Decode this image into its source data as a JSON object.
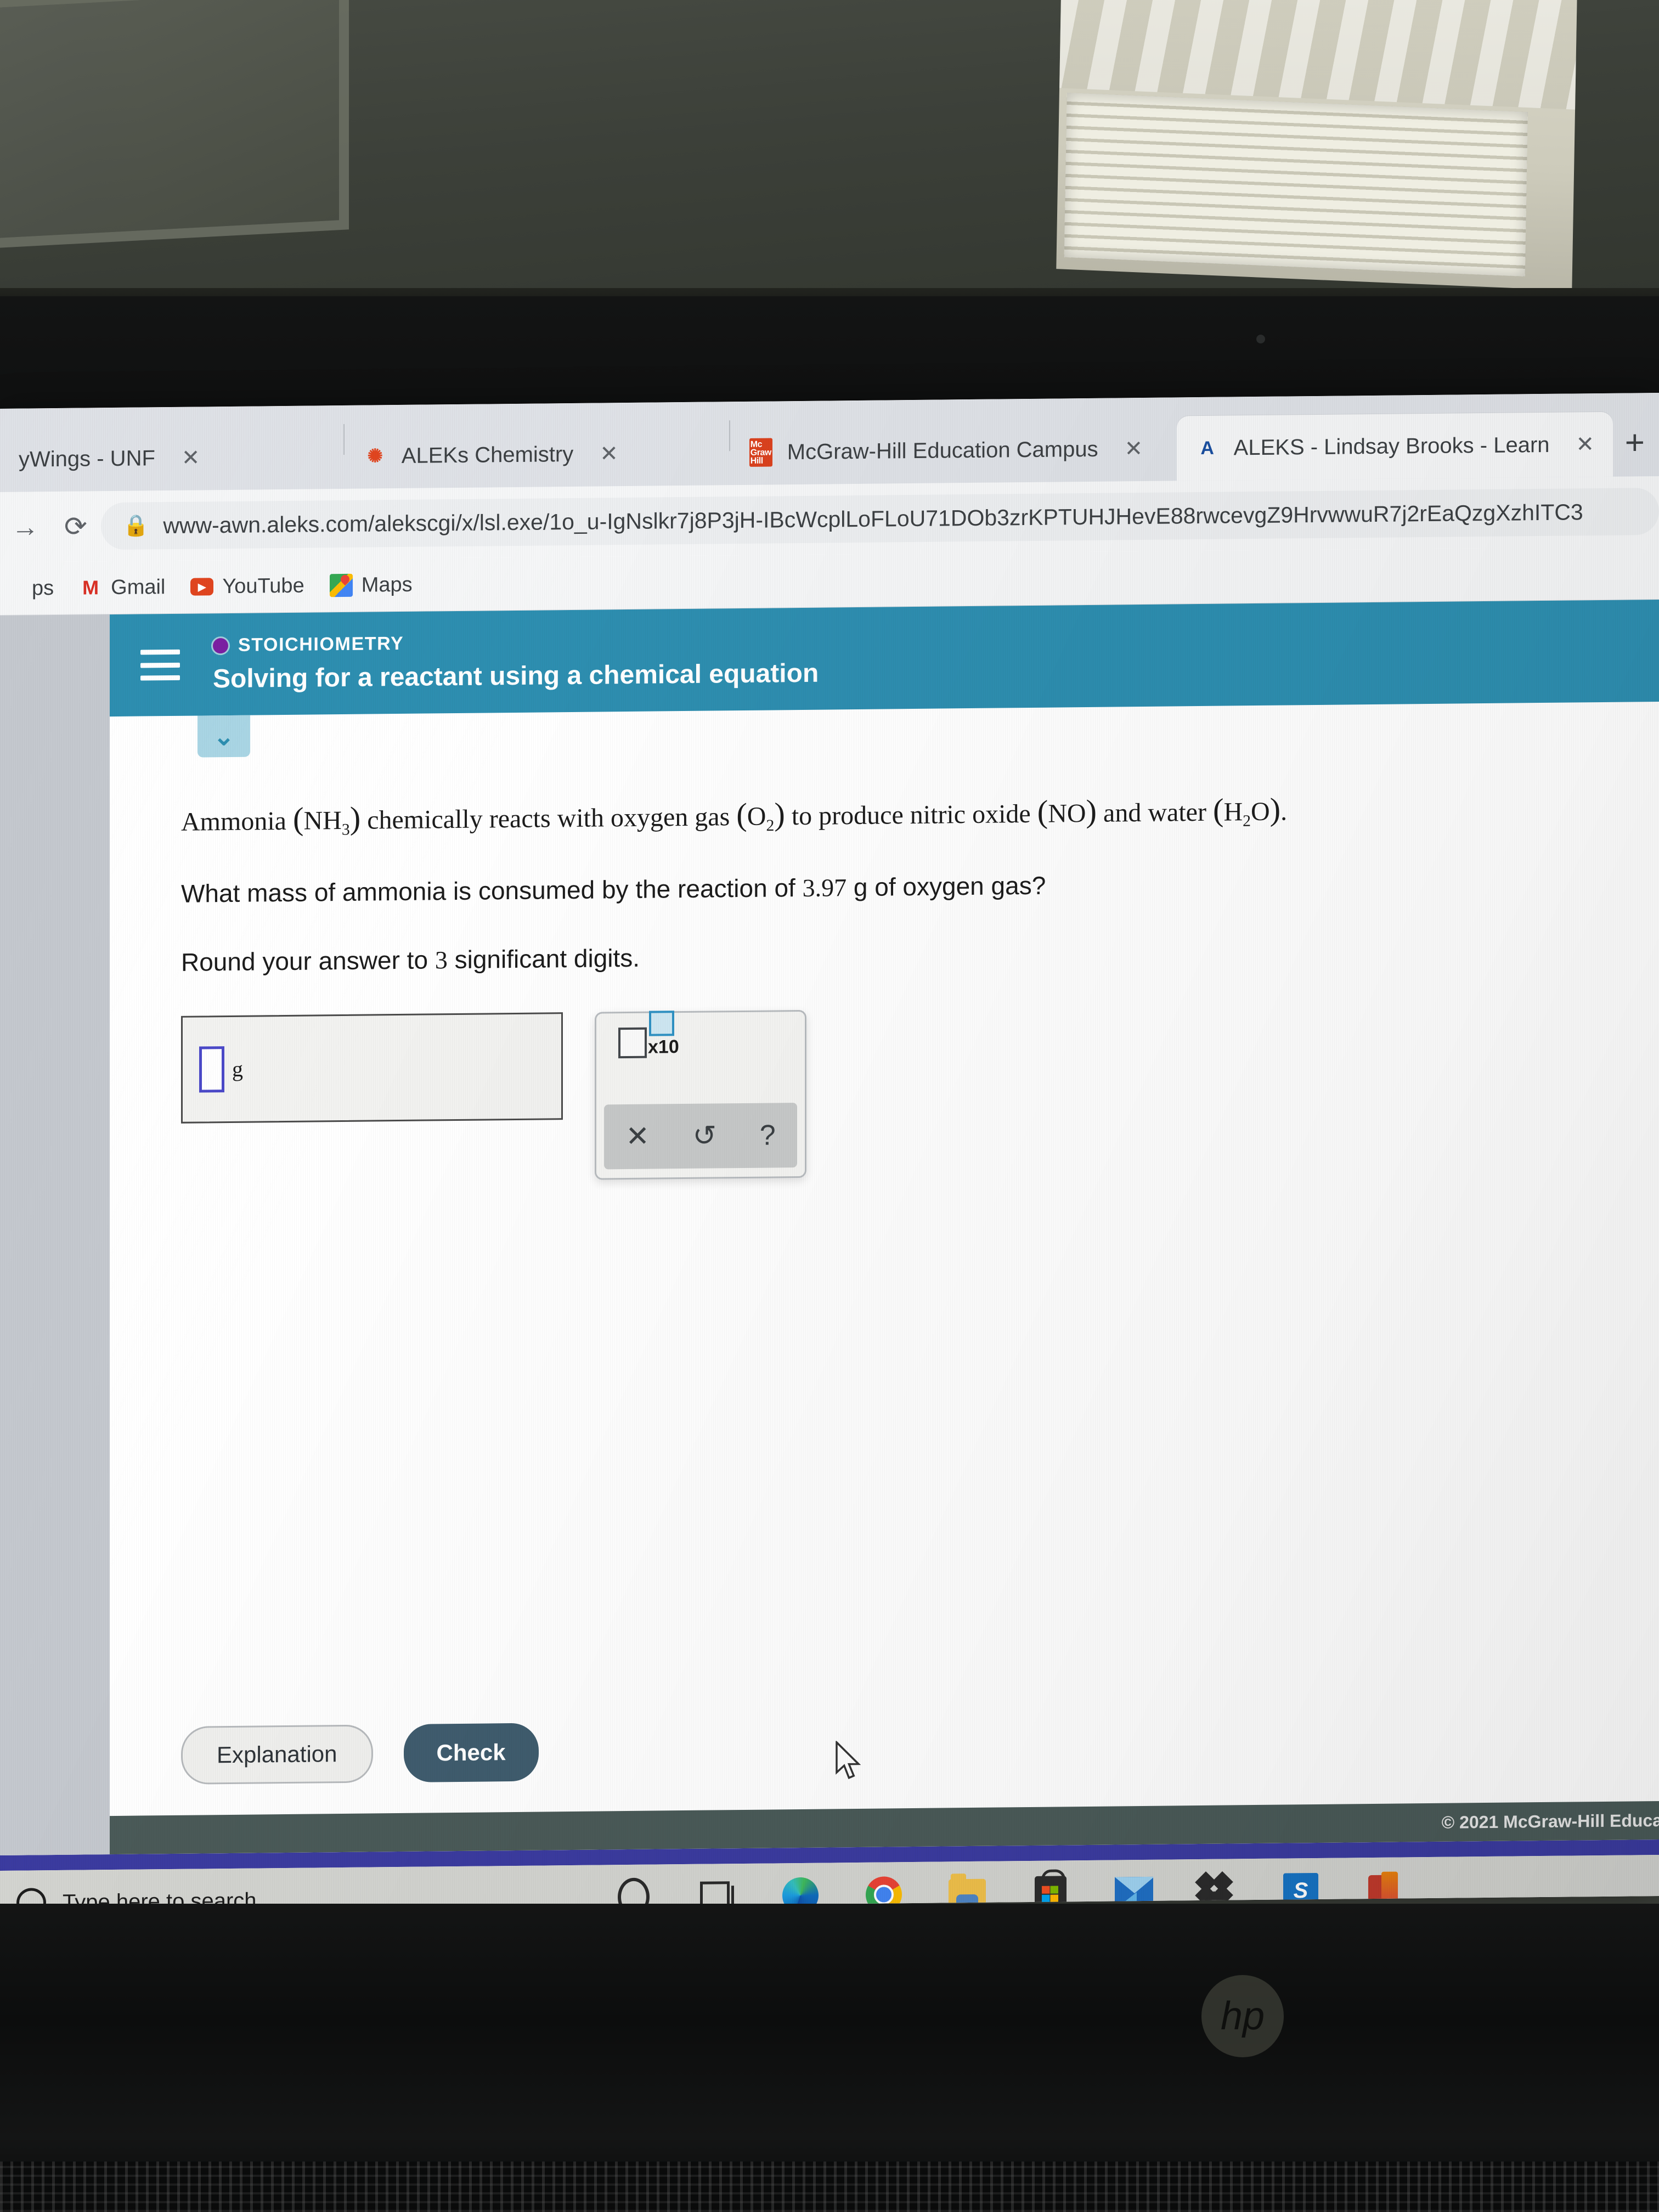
{
  "browser": {
    "tabs": [
      {
        "title": "yWings - UNF",
        "favicon": "none-icon",
        "active": false,
        "close_label": "✕"
      },
      {
        "title": "ALEKs Chemistry",
        "favicon": "aleks-chemistry-icon",
        "active": false,
        "close_label": "✕"
      },
      {
        "title": "McGraw-Hill Education Campus",
        "favicon": "mcgraw-hill-icon",
        "active": false,
        "close_label": "✕"
      },
      {
        "title": "ALEKS - Lindsay Brooks - Learn",
        "favicon": "aleks-icon",
        "active": true,
        "close_label": "✕"
      }
    ],
    "new_tab_label": "+",
    "reload_label": "⟳",
    "forward_label": "→",
    "lock_label": "🔒",
    "url": "www-awn.aleks.com/alekscgi/x/lsl.exe/1o_u-IgNslkr7j8P3jH-IBcWcplLoFLoU71DOb3zrKPTUHJHevE88rwcevgZ9HrvwwuR7j2rEaQzgXzhITC3",
    "bookmarks": [
      {
        "label": "ps",
        "icon": "apps-icon"
      },
      {
        "label": "Gmail",
        "icon": "gmail-icon"
      },
      {
        "label": "YouTube",
        "icon": "youtube-icon"
      },
      {
        "label": "Maps",
        "icon": "maps-icon"
      }
    ]
  },
  "aleks": {
    "menu_icon": "hamburger-menu-icon",
    "topic": "STOICHIOMETRY",
    "lesson_title": "Solving for a reactant using a chemical equation",
    "collapse_chevron": "⌄",
    "question": {
      "line1_prefix": "Ammonia",
      "line1_f1": "NH",
      "line1_f1_sub": "3",
      "line1_mid1": "chemically reacts with oxygen gas",
      "line1_f2": "O",
      "line1_f2_sub": "2",
      "line1_mid2": "to produce nitric oxide",
      "line1_f3": "NO",
      "line1_mid3": "and water",
      "line1_f4a": "H",
      "line1_f4_sub": "2",
      "line1_f4b": "O",
      "line1_end": ".",
      "line2_prefix": "What mass of ammonia is consumed by the reaction of",
      "line2_value": "3.97",
      "line2_suffix": "g of oxygen gas?",
      "line3_prefix": "Round your answer to",
      "line3_value": "3",
      "line3_suffix": "significant digits."
    },
    "answer": {
      "value": "",
      "unit": "g"
    },
    "palette": {
      "sci_base_label": "",
      "sci_x10_label": "x10",
      "sci_exp_label": "",
      "clear_label": "✕",
      "undo_label": "↺",
      "help_label": "?"
    },
    "buttons": {
      "explanation": "Explanation",
      "check": "Check"
    },
    "copyright": "© 2021 McGraw-Hill Educa"
  },
  "taskbar": {
    "search_placeholder": "Type here to search",
    "search_icon": "search-icon",
    "items": [
      {
        "name": "cortana-icon"
      },
      {
        "name": "task-view-icon"
      },
      {
        "name": "microsoft-edge-icon"
      },
      {
        "name": "google-chrome-icon"
      },
      {
        "name": "file-explorer-icon"
      },
      {
        "name": "microsoft-store-icon"
      },
      {
        "name": "mail-icon"
      },
      {
        "name": "dropbox-icon"
      },
      {
        "name": "blue-app-icon"
      },
      {
        "name": "microsoft-office-icon"
      }
    ]
  },
  "device": {
    "brand_logo": "hp"
  },
  "colors": {
    "aleks_header_teal": "#2d8eb0",
    "topic_dot_purple": "#7b1fa2",
    "check_button": "#3f5c6e",
    "footer_bar": "#4a5a58",
    "accent_strip": "#3b3ba0",
    "cursor_blue": "#4b49c8"
  }
}
